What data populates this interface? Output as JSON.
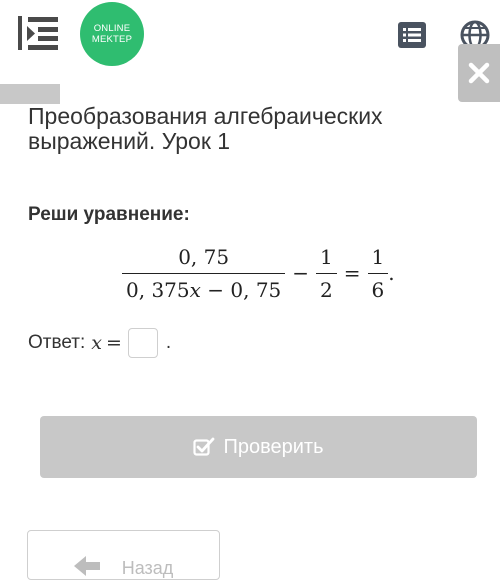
{
  "header": {
    "logo_line1": "ONLINE",
    "logo_line2": "MEKTEP",
    "brand_color": "#2fbd70",
    "menu_icon": "menu-collapse-icon",
    "list_icon": "list-icon",
    "language_icon": "globe-icon",
    "close_icon": "close-icon"
  },
  "lesson": {
    "title": "Преобразования алгебраических выражений. Урок 1"
  },
  "task": {
    "label": "Реши уравнение:",
    "equation": {
      "frac1_num": "0, 75",
      "frac1_den_a": "0, 375",
      "frac1_den_var": "x",
      "frac1_den_b": " − 0, 75",
      "minus": "−",
      "frac2_num": "1",
      "frac2_den": "2",
      "equals": "=",
      "frac3_num": "1",
      "frac3_den": "6",
      "end": "."
    },
    "answer_label": "Ответ:",
    "answer_var": "x",
    "answer_eq": "=",
    "answer_value": "",
    "answer_end": "."
  },
  "actions": {
    "check_label": "Проверить",
    "back_label": "Назад"
  },
  "colors": {
    "button_disabled": "#c8c8c8",
    "text": "#333333"
  }
}
